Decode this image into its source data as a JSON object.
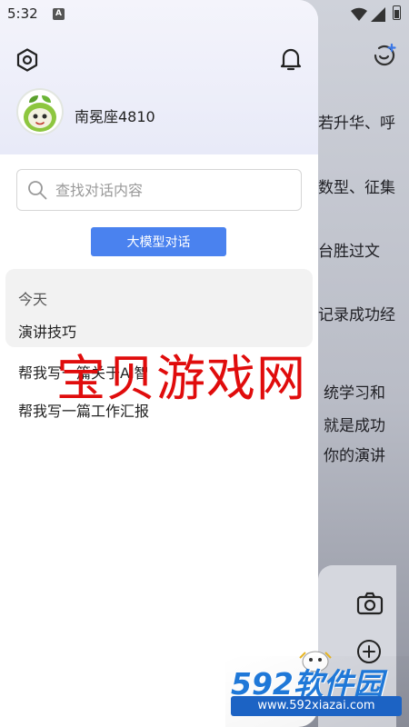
{
  "status_bar": {
    "time": "5:32",
    "a_label": "A",
    "icons": [
      "wifi-icon",
      "signal-icon",
      "battery-icon"
    ]
  },
  "background_page": {
    "lines": [
      "若升华、呼",
      "数型、征集",
      "台胜过文",
      "记录成功经",
      "统学习和",
      "就是成功",
      "你的演讲"
    ],
    "icons": [
      "new-chat-icon",
      "camera-icon",
      "plus-icon"
    ]
  },
  "drawer": {
    "header_icons": [
      "settings-hexagon-icon",
      "bell-icon"
    ],
    "username": "南冕座4810",
    "search": {
      "placeholder": "查找对话内容",
      "value": ""
    },
    "new_chat_label": "大模型对话",
    "history": {
      "today_heading": "今天",
      "items": [
        "演讲技巧",
        "帮我写一篇关于AI智",
        "帮我写一篇工作汇报"
      ]
    }
  },
  "watermarks": {
    "main_text": "宝贝游戏网",
    "corner_title": "592软件园",
    "corner_url": "www.592xiazai.com"
  },
  "colors": {
    "accent": "#4a82ef",
    "watermark_red": "#e00c0c",
    "watermark_blue": "#1f78d8"
  }
}
